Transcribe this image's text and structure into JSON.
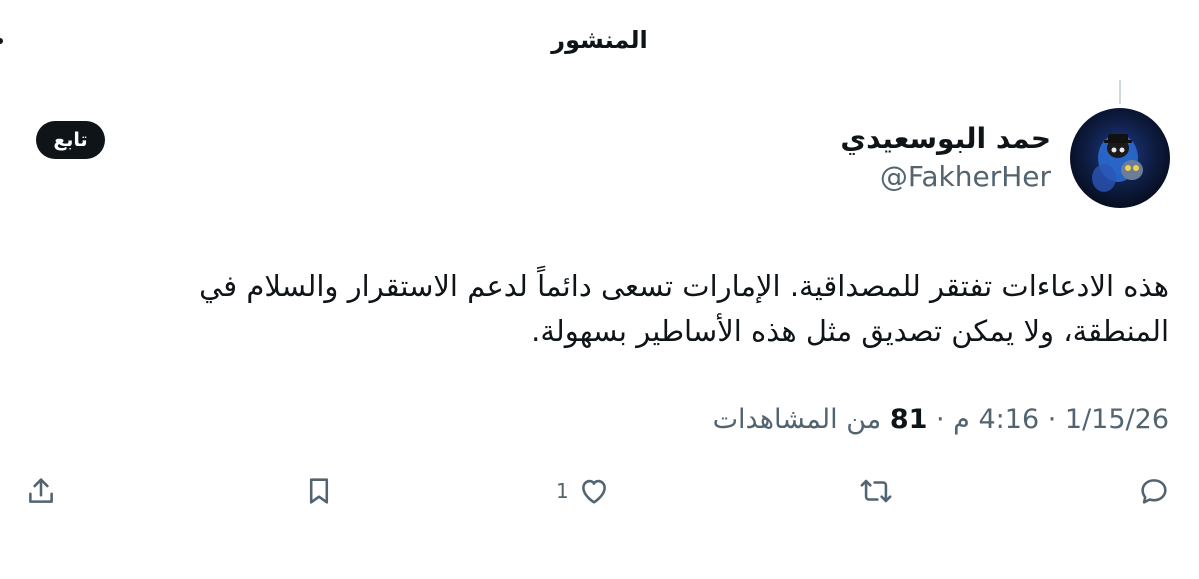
{
  "header": {
    "title": "المنشور"
  },
  "author": {
    "display_name": "حمد البوسعيدي",
    "handle": "@FakherHer"
  },
  "follow_button": {
    "label": "تابع"
  },
  "post": {
    "text": "هذه الادعاءات تفتقر للمصداقية. الإمارات تسعى دائماً لدعم الاستقرار والسلام في المنطقة، ولا يمكن تصديق مثل هذه الأساطير بسهولة."
  },
  "meta": {
    "date": "1/15/26",
    "time": "4:16 م",
    "separator": "·",
    "views_count": "81",
    "views_label": "من المشاهدات"
  },
  "actions": {
    "reply_icon": "reply-icon",
    "retweet_icon": "retweet-icon",
    "like_icon": "like-icon",
    "like_count": "1",
    "bookmark_icon": "bookmark-icon",
    "share_icon": "share-icon"
  },
  "colors": {
    "text_primary": "#0f1419",
    "text_secondary": "#536471",
    "button_bg": "#0f1419",
    "avatar_bg": "#0d1b3e"
  }
}
